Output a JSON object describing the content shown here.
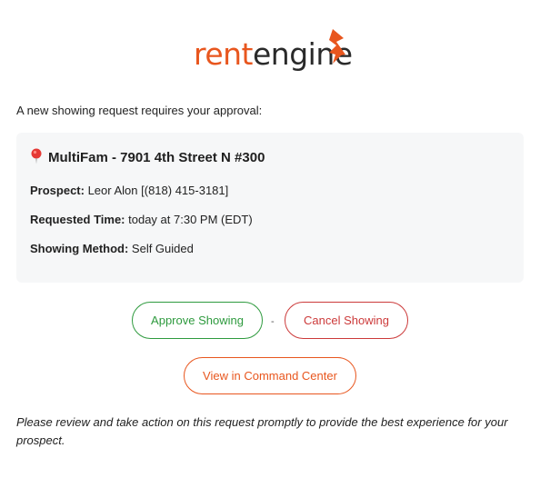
{
  "brand": {
    "logo_part1": "rent",
    "logo_part2": "engine",
    "primary_color": "#e8561e"
  },
  "intro_text": "A new showing request requires your approval:",
  "property": {
    "icon": "map-pin-icon",
    "title": "MultiFam - 7901 4th Street N #300"
  },
  "details": {
    "prospect_label": "Prospect:",
    "prospect_value": " Leor Alon [(818) 415-3181]",
    "time_label": "Requested Time:",
    "time_value": " today at 7:30 PM (EDT)",
    "method_label": "Showing Method:",
    "method_value": " Self Guided"
  },
  "actions": {
    "approve_label": "Approve Showing",
    "separator": "-",
    "cancel_label": "Cancel Showing",
    "view_label": "View in Command Center",
    "approve_color": "#2e9a3e",
    "cancel_color": "#cc3a3a"
  },
  "footer_text": "Please review and take action on this request promptly to provide the best experience for your prospect."
}
